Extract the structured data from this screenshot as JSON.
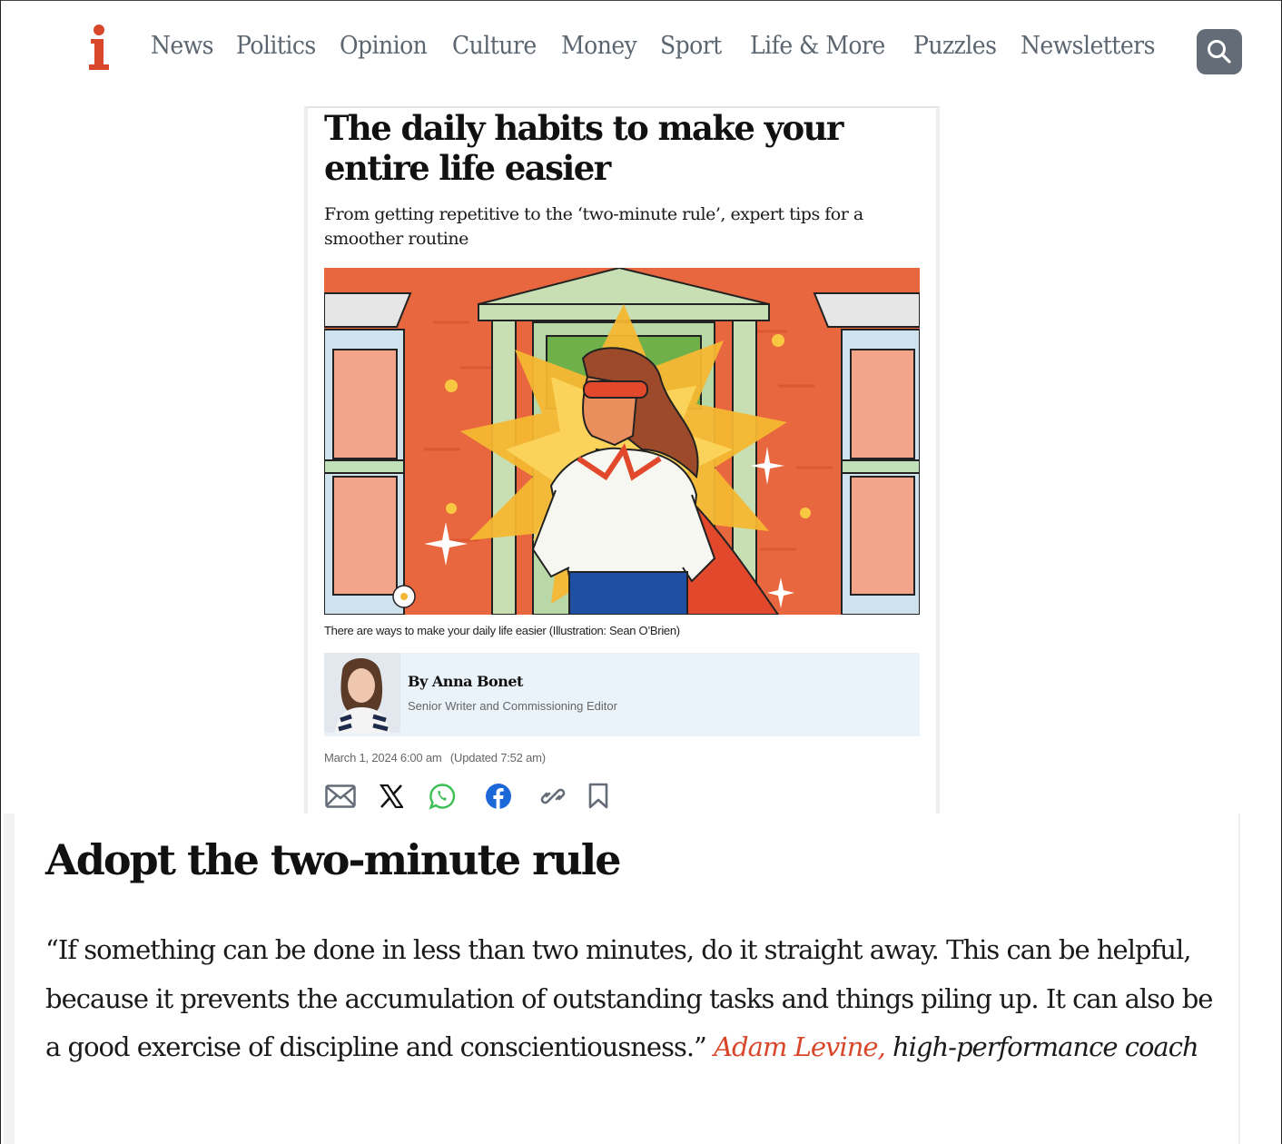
{
  "brand": {
    "logo_letter": "i",
    "accent_color": "#d9472b"
  },
  "nav": {
    "items": [
      {
        "label": "News"
      },
      {
        "label": "Politics"
      },
      {
        "label": "Opinion"
      },
      {
        "label": "Culture"
      },
      {
        "label": "Money"
      },
      {
        "label": "Sport"
      },
      {
        "label": "Life & More"
      },
      {
        "label": "Puzzles"
      },
      {
        "label": "Newsletters"
      }
    ],
    "search_icon": "search-icon"
  },
  "article": {
    "headline": "The daily habits to make your entire life easier",
    "standfirst": "From getting repetitive to the ‘two-minute rule’, expert tips for a smoother routine",
    "image_caption": "There are ways to make your daily life easier (Illustration: Sean O’Brien)",
    "author": {
      "byline": "By Anna Bonet",
      "role": "Senior Writer and Commissioning Editor"
    },
    "date": "March 1, 2024 6:00 am",
    "updated": "(Updated 7:52 am)",
    "share": [
      {
        "icon": "email-icon"
      },
      {
        "icon": "x-icon"
      },
      {
        "icon": "whatsapp-icon"
      },
      {
        "icon": "facebook-icon"
      },
      {
        "icon": "link-icon"
      },
      {
        "icon": "bookmark-icon"
      }
    ]
  },
  "section": {
    "heading": "Adopt the two-minute rule",
    "quote": "“If something can be done in less than two minutes, do it straight away. This can be helpful, because it prevents the accumulation of outstanding tasks and things piling up. It can also be a good exercise of discipline and conscientiousness.”",
    "attribution_name": "Adam Levine,",
    "attribution_role": "high-performance coach"
  }
}
